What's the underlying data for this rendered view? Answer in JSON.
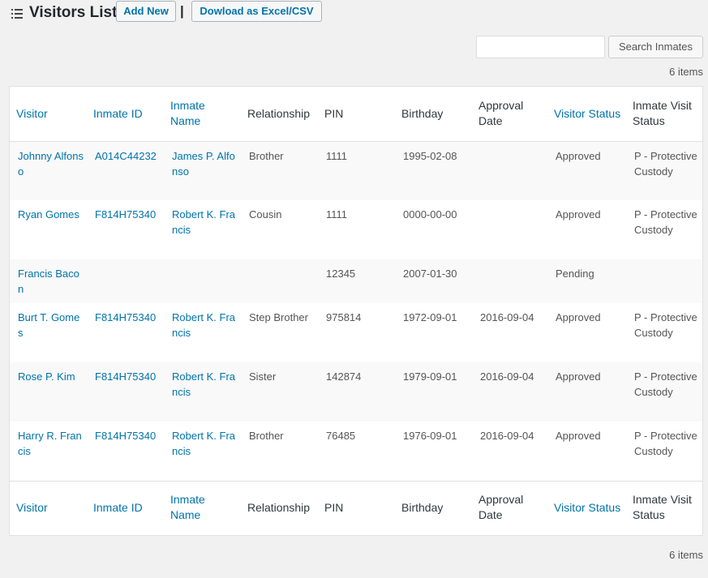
{
  "header": {
    "title": "Visitors List",
    "add_new_label": "Add New",
    "separator": "|",
    "export_label": "Dowload as Excel/CSV"
  },
  "search": {
    "value": "",
    "placeholder": "",
    "button_label": "Search Inmates"
  },
  "items_count": "6 items",
  "table": {
    "columns": [
      "Visitor",
      "Inmate ID",
      "Inmate Name",
      "Relationship",
      "PIN",
      "Birthday",
      "Approval Date",
      "Visitor Status",
      "Inmate Visit Status"
    ],
    "rows": [
      {
        "visitor": "Johnny Alfonso",
        "inmate_id": "A014C44232",
        "inmate_name": "James P. Alfonso",
        "relationship": "Brother",
        "pin": "1111",
        "birthday": "1995-02-08",
        "approval_date": "",
        "visitor_status": "Approved",
        "inmate_visit_status": "P - Protective Custody"
      },
      {
        "visitor": "Ryan Gomes",
        "inmate_id": "F814H75340",
        "inmate_name": "Robert K. Francis",
        "relationship": "Cousin",
        "pin": "1111",
        "birthday": "0000-00-00",
        "approval_date": "",
        "visitor_status": "Approved",
        "inmate_visit_status": "P - Protective Custody"
      },
      {
        "visitor": "Francis Bacon",
        "inmate_id": "",
        "inmate_name": "",
        "relationship": "",
        "pin": "12345",
        "birthday": "2007-01-30",
        "approval_date": "",
        "visitor_status": "Pending",
        "inmate_visit_status": ""
      },
      {
        "visitor": "Burt T. Gomes",
        "inmate_id": "F814H75340",
        "inmate_name": "Robert K. Francis",
        "relationship": "Step Brother",
        "pin": "975814",
        "birthday": "1972-09-01",
        "approval_date": "2016-09-04",
        "visitor_status": "Approved",
        "inmate_visit_status": "P - Protective Custody"
      },
      {
        "visitor": "Rose P. Kim",
        "inmate_id": "F814H75340",
        "inmate_name": "Robert K. Francis",
        "relationship": "Sister",
        "pin": "142874",
        "birthday": "1979-09-01",
        "approval_date": "2016-09-04",
        "visitor_status": "Approved",
        "inmate_visit_status": "P - Protective Custody"
      },
      {
        "visitor": "Harry R. Francis",
        "inmate_id": "F814H75340",
        "inmate_name": "Robert K. Francis",
        "relationship": "Brother",
        "pin": "76485",
        "birthday": "1976-09-01",
        "approval_date": "2016-09-04",
        "visitor_status": "Approved",
        "inmate_visit_status": "P - Protective Custody"
      }
    ]
  },
  "colors": {
    "link": "#0073aa",
    "background": "#f1f1f1",
    "alt_row": "#f9f9f9"
  },
  "icons": {
    "title_icon": "list-icon"
  }
}
